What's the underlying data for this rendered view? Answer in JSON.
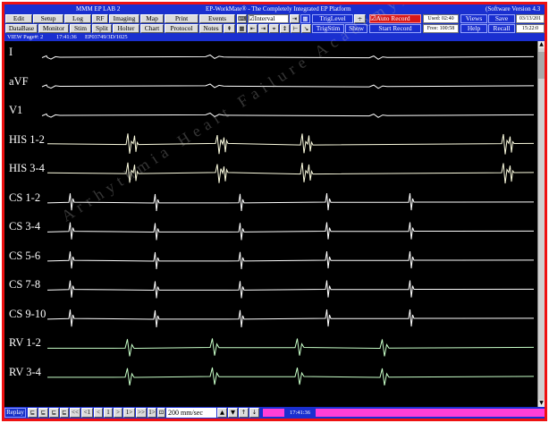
{
  "window": {
    "lab_title": "MMM  EP  LAB  2",
    "app_title": "EP-WorkMate® - The Completely Integrated EP Platform",
    "version": "(Software Version 4.3"
  },
  "toolbar": {
    "row1": {
      "edit": "Edit",
      "setup": "Setup",
      "log": "Log",
      "rf": "RF",
      "imaging": "Imaging",
      "map": "Map",
      "print": "Print",
      "events": "Events",
      "interval": "Interval",
      "triglevel": "TrigLevel",
      "auto_record": "Auto Record",
      "used": "Used: 02:40",
      "views": "Views",
      "save": "Save",
      "date": "03/13/201"
    },
    "row2": {
      "database": "DataBase",
      "monitor": "Monitor",
      "stim": "Stim",
      "split": "Split",
      "holter": "Holter",
      "chart": "Chart",
      "protocol": "Protocol",
      "notes": "Notes",
      "trigstim": "TrigStim",
      "show": "Show",
      "start_record": "Start Record",
      "free": "Free: 100:58",
      "help": "Help",
      "recall": "Recall",
      "clock": "15:22:0"
    }
  },
  "review_strip": {
    "page": "VIEW Page#: 2",
    "time": "17:41:36",
    "record_id": "EP03749/3D/1025"
  },
  "channels": [
    {
      "label": "I",
      "color": "#ffffff"
    },
    {
      "label": "aVF",
      "color": "#ffffff"
    },
    {
      "label": "V1",
      "color": "#ffffff"
    },
    {
      "label": "HIS 1-2",
      "color": "#fdfde0"
    },
    {
      "label": "HIS 3-4",
      "color": "#fdfde0"
    },
    {
      "label": "CS 1-2",
      "color": "#ffffff"
    },
    {
      "label": "CS 3-4",
      "color": "#ffffff"
    },
    {
      "label": "CS 5-6",
      "color": "#ffffff"
    },
    {
      "label": "CS 7-8",
      "color": "#ffffff"
    },
    {
      "label": "CS 9-10",
      "color": "#ffffff"
    },
    {
      "label": "RV 1-2",
      "color": "#c8ffc8"
    },
    {
      "label": "RV 3-4",
      "color": "#c8ffc8"
    }
  ],
  "watermark": "Arrhythmia Heart Failure Academy, MMM",
  "bottombar": {
    "replay": "Replay",
    "page_prev2": "<<",
    "page_prev": "<1",
    "step_back": "<",
    "page_num": "1",
    "step_fwd": ">",
    "page_next": "1>",
    "page_next2": ">>",
    "page_end": "1>",
    "speed": "200 mm/sec",
    "time": "17:41:36"
  },
  "colors": {
    "frame_border": "#ee1111",
    "toolbar_blue": "#1a2fd0",
    "record_red": "#d81818",
    "timeline_pink": "#ff3fd8"
  }
}
